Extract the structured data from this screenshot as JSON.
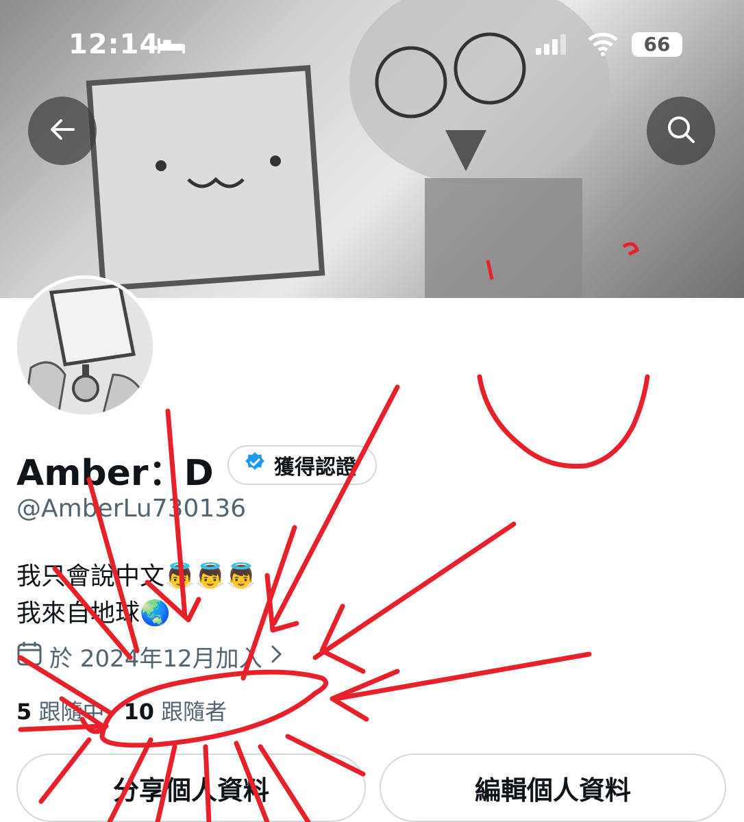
{
  "status_bar": {
    "time": "12:14",
    "battery": "66"
  },
  "icons": {
    "back": "arrow-left-icon",
    "search": "search-icon",
    "verified": "verified-badge-icon",
    "calendar": "calendar-icon",
    "chevron": "chevron-right-icon"
  },
  "profile": {
    "display_name": "Amber：D",
    "verify_label": "獲得認證",
    "handle": "@AmberLu730136",
    "bio_line1": "我只會說中文👼👼👼",
    "bio_line2": "我來自地球🌏",
    "joined": "於 2024年12月加入",
    "following_count": "5",
    "following_label": "跟隨中",
    "followers_count": "10",
    "followers_label": "跟隨者"
  },
  "actions": {
    "share": "分享個人資料",
    "edit": "編輯個人資料"
  },
  "colors": {
    "text_primary": "#0f1419",
    "text_secondary": "#536471",
    "verified_blue": "#1d9bf0",
    "annotation_red": "#e8202a",
    "border": "#cfd9de"
  }
}
